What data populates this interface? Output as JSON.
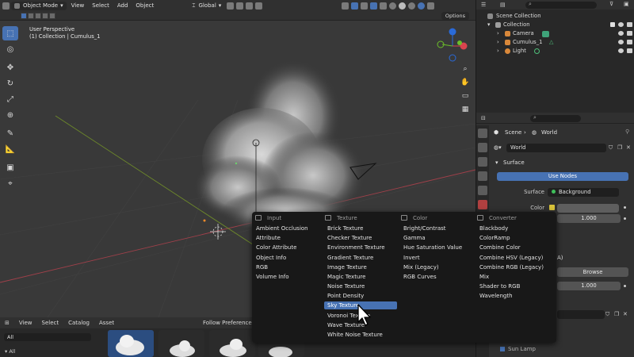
{
  "header": {
    "mode": "Object Mode",
    "menus": [
      "View",
      "Select",
      "Add",
      "Object"
    ],
    "transform": "Global",
    "options": "Options"
  },
  "viewport": {
    "perspective": "User Perspective",
    "context": "(1) Collection | Cumulus_1"
  },
  "outliner": {
    "scene_collection": "Scene Collection",
    "collection": "Collection",
    "items": [
      "Camera",
      "Cumulus_1",
      "Light"
    ]
  },
  "properties": {
    "scene": "Scene",
    "world_crumb": "World",
    "world_name": "World",
    "surface_section": "Surface",
    "use_nodes": "Use Nodes",
    "surface_label": "Surface",
    "surface_value": "Background",
    "color_label": "Color",
    "strength": "1.000",
    "partial_a": "A)",
    "browse": "Browse",
    "value2": "1.000",
    "sun_lamp": "Sun Lamp"
  },
  "asset_browser": {
    "menus": [
      "View",
      "Select",
      "Catalog",
      "Asset"
    ],
    "follow_prefs": "Follow Preferences",
    "library": "All",
    "tree_all": "All"
  },
  "add_menu": {
    "columns": [
      {
        "title": "Input",
        "items": [
          "Ambient Occlusion",
          "Attribute",
          "Color Attribute",
          "Object Info",
          "RGB",
          "Volume Info"
        ]
      },
      {
        "title": "Texture",
        "items": [
          "Brick Texture",
          "Checker Texture",
          "Environment Texture",
          "Gradient Texture",
          "Image Texture",
          "Magic Texture",
          "Noise Texture",
          "Point Density",
          "Sky Texture",
          "Voronoi Texture",
          "Wave Texture",
          "White Noise Texture"
        ]
      },
      {
        "title": "Color",
        "items": [
          "Bright/Contrast",
          "Gamma",
          "Hue Saturation Value",
          "Invert",
          "Mix (Legacy)",
          "RGB Curves"
        ]
      },
      {
        "title": "Converter",
        "items": [
          "Blackbody",
          "ColorRamp",
          "Combine Color",
          "Combine HSV (Legacy)",
          "Combine RGB (Legacy)",
          "Mix",
          "Shader to RGB",
          "Wavelength"
        ]
      }
    ],
    "highlighted": "Sky Texture"
  },
  "colors": {
    "accent": "#4772b3",
    "menu_bg": "#181818",
    "viewport_bg": "#393939"
  }
}
